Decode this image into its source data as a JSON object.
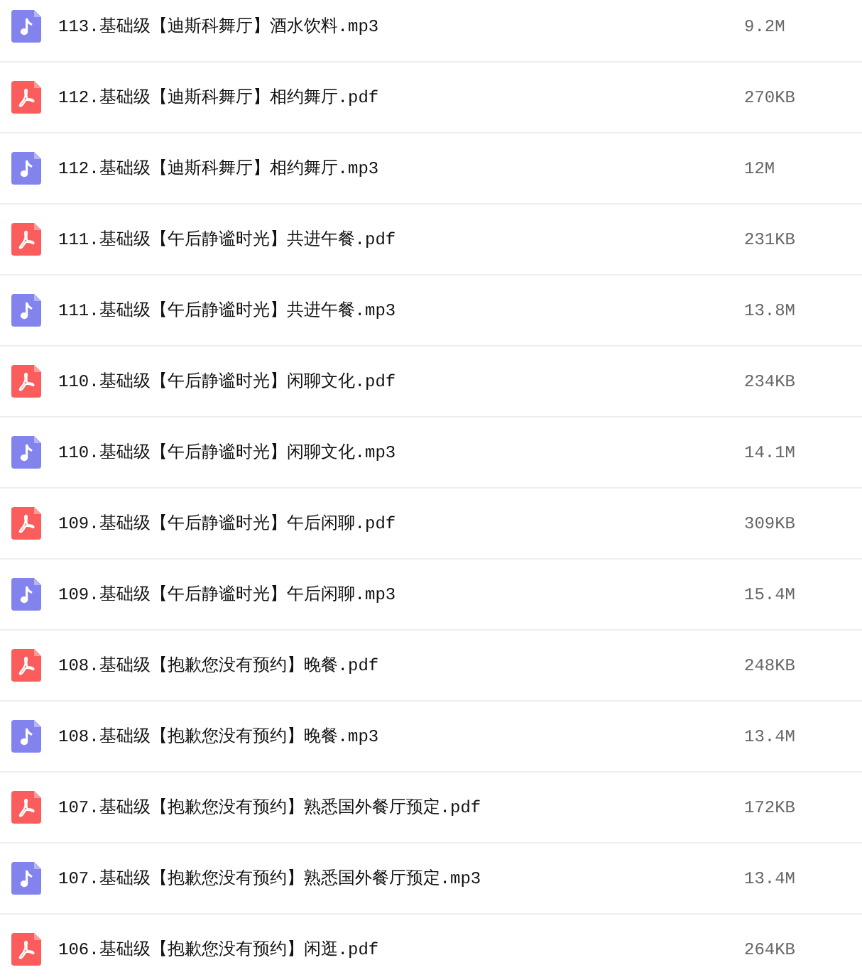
{
  "files": [
    {
      "kind": "audio",
      "name": "113.基础级【迪斯科舞厅】酒水饮料.mp3",
      "size": "9.2M"
    },
    {
      "kind": "pdf",
      "name": "112.基础级【迪斯科舞厅】相约舞厅.pdf",
      "size": "270KB"
    },
    {
      "kind": "audio",
      "name": "112.基础级【迪斯科舞厅】相约舞厅.mp3",
      "size": "12M"
    },
    {
      "kind": "pdf",
      "name": "111.基础级【午后静谧时光】共进午餐.pdf",
      "size": "231KB"
    },
    {
      "kind": "audio",
      "name": "111.基础级【午后静谧时光】共进午餐.mp3",
      "size": "13.8M"
    },
    {
      "kind": "pdf",
      "name": "110.基础级【午后静谧时光】闲聊文化.pdf",
      "size": "234KB"
    },
    {
      "kind": "audio",
      "name": "110.基础级【午后静谧时光】闲聊文化.mp3",
      "size": "14.1M"
    },
    {
      "kind": "pdf",
      "name": "109.基础级【午后静谧时光】午后闲聊.pdf",
      "size": "309KB"
    },
    {
      "kind": "audio",
      "name": "109.基础级【午后静谧时光】午后闲聊.mp3",
      "size": "15.4M"
    },
    {
      "kind": "pdf",
      "name": "108.基础级【抱歉您没有预约】晚餐.pdf",
      "size": "248KB"
    },
    {
      "kind": "audio",
      "name": "108.基础级【抱歉您没有预约】晚餐.mp3",
      "size": "13.4M"
    },
    {
      "kind": "pdf",
      "name": "107.基础级【抱歉您没有预约】熟悉国外餐厅预定.pdf",
      "size": "172KB"
    },
    {
      "kind": "audio",
      "name": "107.基础级【抱歉您没有预约】熟悉国外餐厅预定.mp3",
      "size": "13.4M"
    },
    {
      "kind": "pdf",
      "name": "106.基础级【抱歉您没有预约】闲逛.pdf",
      "size": "264KB"
    }
  ]
}
